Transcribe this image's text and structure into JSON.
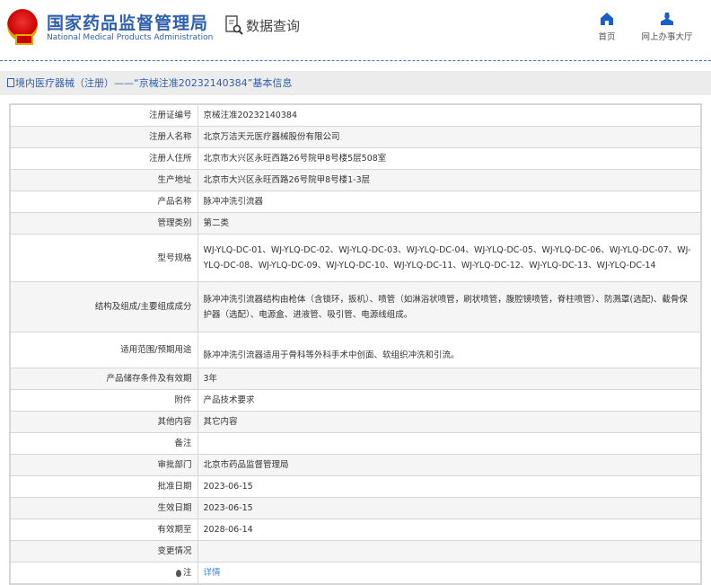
{
  "header": {
    "org_cn": "国家药品监督管理局",
    "org_en": "National Medical Products Administration",
    "section": "数据查询",
    "nav": [
      {
        "label": "首页"
      },
      {
        "label": "网上办事大厅"
      }
    ]
  },
  "breadcrumb": "境内医疗器械（注册）——“京械注准20232140384”基本信息",
  "rows": [
    {
      "label": "注册证编号",
      "value": "京械注准20232140384"
    },
    {
      "label": "注册人名称",
      "value": "北京万洁天元医疗器械股份有限公司"
    },
    {
      "label": "注册人住所",
      "value": "北京市大兴区永旺西路26号院甲8号楼5层508室"
    },
    {
      "label": "生产地址",
      "value": "北京市大兴区永旺西路26号院甲8号楼1-3层"
    },
    {
      "label": "产品名称",
      "value": "脉冲冲洗引流器"
    },
    {
      "label": "管理类别",
      "value": "第二类"
    },
    {
      "label": "型号规格",
      "value": "WJ-YLQ-DC-01、WJ-YLQ-DC-02、WJ-YLQ-DC-03、WJ-YLQ-DC-04、WJ-YLQ-DC-05、WJ-YLQ-DC-06、WJ-YLQ-DC-07、WJ-YLQ-DC-08、WJ-YLQ-DC-09、WJ-YLQ-DC-10、WJ-YLQ-DC-11、WJ-YLQ-DC-12、WJ-YLQ-DC-13、WJ-YLQ-DC-14"
    },
    {
      "label": "结构及组成/主要组成成分",
      "value": "脉冲冲洗引流器结构由枪体（含锁环，扳机）、喷管（如淋浴状喷管，刷状喷管，腹腔镜喷管，脊柱喷管）、防溅罩(选配)、截骨保护器（选配）、电源盒、进液管、吸引管、电源线组成。"
    },
    {
      "label": "适用范围/预期用途",
      "value": "脉冲冲洗引流器适用于骨科等外科手术中创面、软组织冲洗和引流。"
    },
    {
      "label": "产品储存条件及有效期",
      "value": "3年"
    },
    {
      "label": "附件",
      "value": "产品技术要求"
    },
    {
      "label": "其他内容",
      "value": "其它内容"
    },
    {
      "label": "备注",
      "value": ""
    },
    {
      "label": "审批部门",
      "value": "北京市药品监督管理局"
    },
    {
      "label": "批准日期",
      "value": "2023-06-15"
    },
    {
      "label": "生效日期",
      "value": "2023-06-15"
    },
    {
      "label": "有效期至",
      "value": "2028-06-14"
    },
    {
      "label": "变更情况",
      "value": ""
    },
    {
      "label": "注",
      "value": "详情"
    }
  ]
}
